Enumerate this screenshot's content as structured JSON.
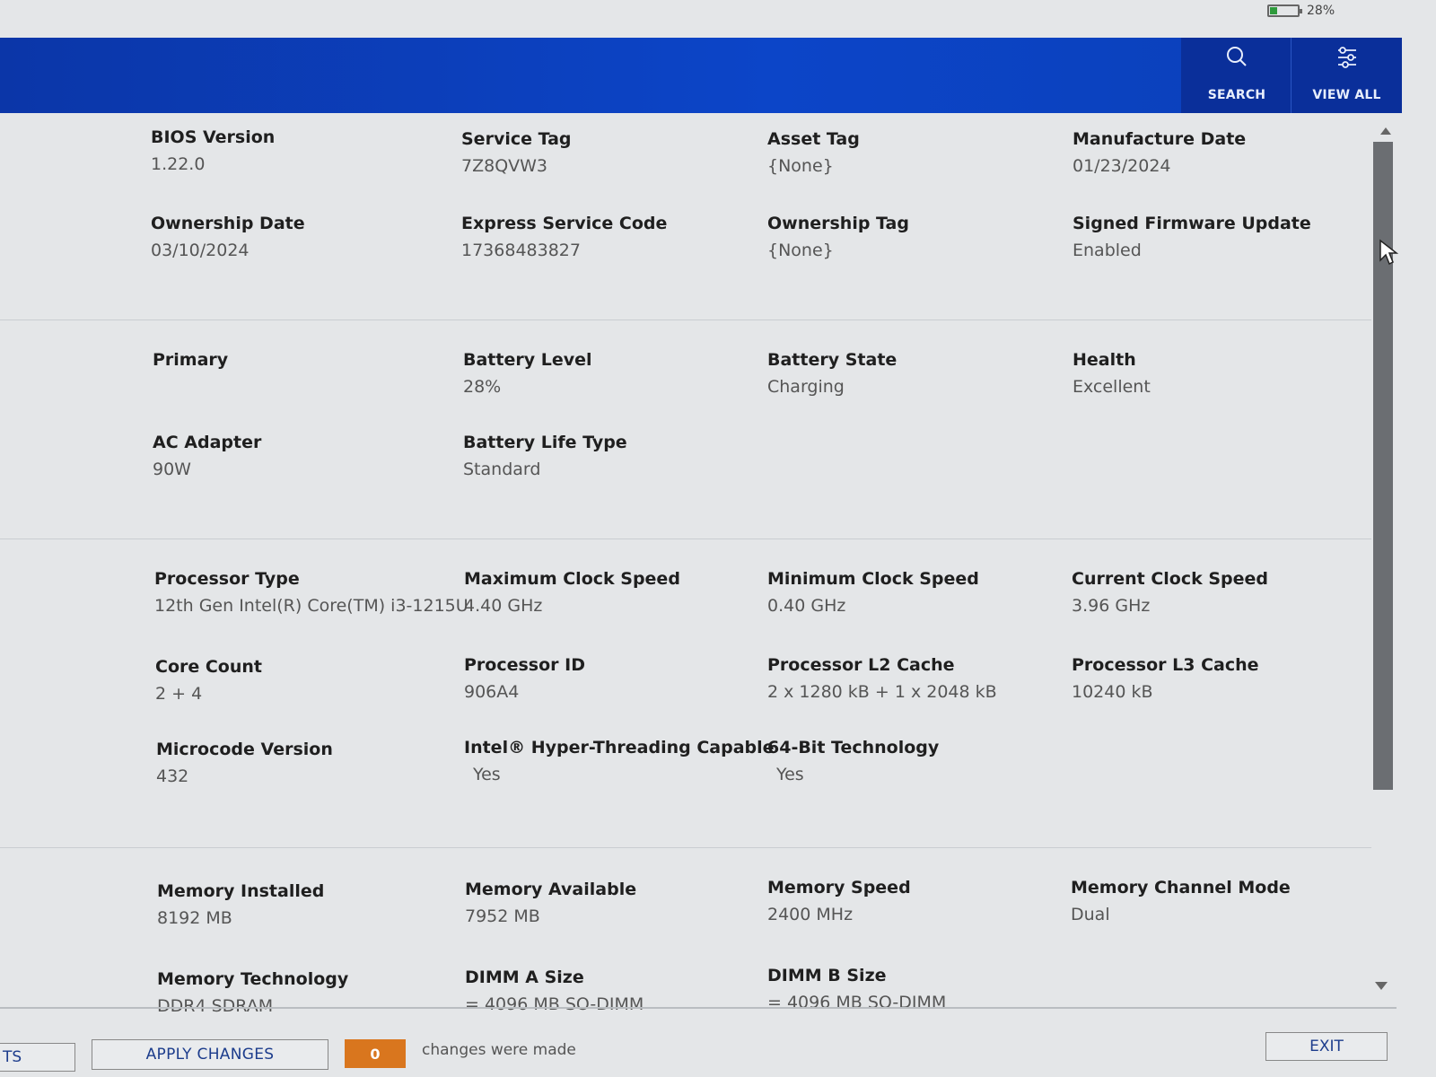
{
  "status_bar": {
    "battery_percent": "28%",
    "battery_level": 0.28
  },
  "header": {
    "search_label": "SEARCH",
    "search_icon": "search-icon",
    "view_all_label": "VIEW ALL",
    "view_all_icon": "settings-sliders-icon",
    "color": "#0c45c8"
  },
  "system_info": {
    "bios_version": {
      "label": "BIOS Version",
      "value": "1.22.0"
    },
    "service_tag": {
      "label": "Service Tag",
      "value": "7Z8QVW3"
    },
    "asset_tag": {
      "label": "Asset Tag",
      "value": "{None}"
    },
    "manufacture_date": {
      "label": "Manufacture Date",
      "value": "01/23/2024"
    },
    "ownership_date": {
      "label": "Ownership Date",
      "value": "03/10/2024"
    },
    "express_service_code": {
      "label": "Express Service Code",
      "value": "17368483827"
    },
    "ownership_tag": {
      "label": "Ownership Tag",
      "value": "{None}"
    },
    "signed_firmware_update": {
      "label": "Signed Firmware Update",
      "value": "Enabled"
    }
  },
  "battery_info": {
    "primary": {
      "label": "Primary",
      "value": ""
    },
    "battery_level": {
      "label": "Battery Level",
      "value": "28%"
    },
    "battery_state": {
      "label": "Battery State",
      "value": "Charging"
    },
    "health": {
      "label": "Health",
      "value": "Excellent"
    },
    "ac_adapter": {
      "label": "AC Adapter",
      "value": "90W"
    },
    "battery_life_type": {
      "label": "Battery Life Type",
      "value": "Standard"
    }
  },
  "processor_info": {
    "processor_type": {
      "label": "Processor Type",
      "value": "12th Gen Intel(R) Core(TM) i3-1215U"
    },
    "max_clock_speed": {
      "label": "Maximum Clock Speed",
      "value": "4.40 GHz"
    },
    "min_clock_speed": {
      "label": "Minimum Clock Speed",
      "value": "0.40 GHz"
    },
    "current_clock_speed": {
      "label": "Current Clock Speed",
      "value": "3.96 GHz"
    },
    "core_count": {
      "label": "Core Count",
      "value": "2 + 4"
    },
    "processor_id": {
      "label": "Processor ID",
      "value": "906A4"
    },
    "l2_cache": {
      "label": "Processor L2 Cache",
      "value": "2 x 1280  kB + 1 x 2048  kB"
    },
    "l3_cache": {
      "label": "Processor L3 Cache",
      "value": "10240 kB"
    },
    "microcode_version": {
      "label": "Microcode Version",
      "value": "432"
    },
    "hyper_threading": {
      "label": "Intel® Hyper-Threading Capable",
      "value": "Yes"
    },
    "bit64": {
      "label": "64-Bit Technology",
      "value": "Yes"
    }
  },
  "memory_info": {
    "memory_installed": {
      "label": "Memory Installed",
      "value": "8192 MB"
    },
    "memory_available": {
      "label": "Memory Available",
      "value": "7952 MB"
    },
    "memory_speed": {
      "label": "Memory Speed",
      "value": "2400 MHz"
    },
    "memory_channel_mode": {
      "label": "Memory Channel Mode",
      "value": "Dual"
    },
    "memory_technology": {
      "label": "Memory Technology",
      "value": "DDR4 SDRAM"
    },
    "dimm_a_size": {
      "label": "DIMM A Size",
      "value": "= 4096 MB SO-DIMM"
    },
    "dimm_b_size": {
      "label": "DIMM B Size",
      "value": "= 4096 MB SO-DIMM"
    }
  },
  "footer": {
    "left_tab_label": "TS",
    "apply_changes_label": "APPLY CHANGES",
    "changes_count": "0",
    "changes_text": "changes were made",
    "exit_label": "EXIT",
    "counter_color": "#d9761e"
  }
}
